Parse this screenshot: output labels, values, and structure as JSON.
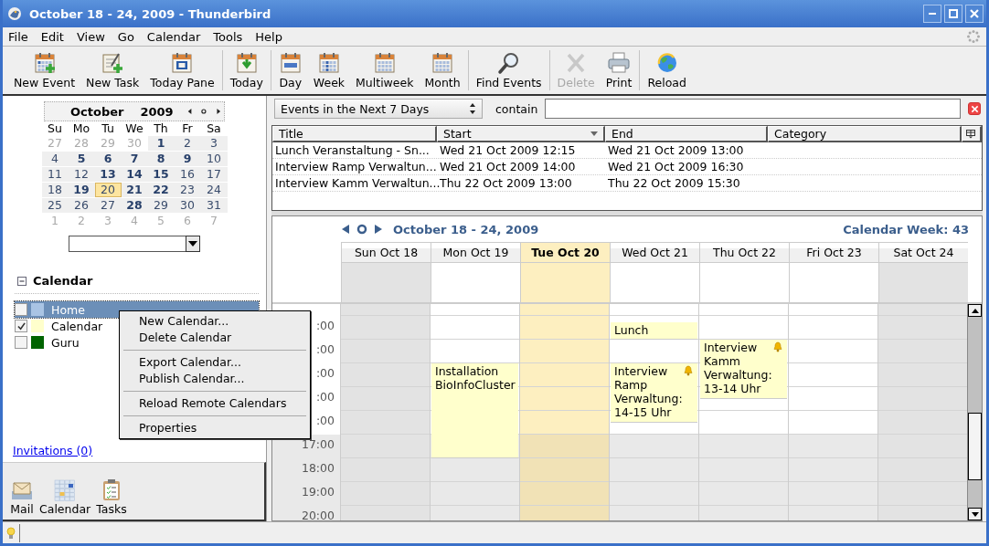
{
  "window": {
    "title": "October 18 - 24, 2009 - Thunderbird"
  },
  "menubar": [
    {
      "label": "File"
    },
    {
      "label": "Edit"
    },
    {
      "label": "View"
    },
    {
      "label": "Go"
    },
    {
      "label": "Calendar"
    },
    {
      "label": "Tools"
    },
    {
      "label": "Help"
    }
  ],
  "toolbar": [
    [
      {
        "label": "New Event",
        "kind": "new-event",
        "disabled": false
      },
      {
        "label": "New Task",
        "kind": "new-task",
        "disabled": false
      },
      {
        "label": "Today Pane",
        "kind": "today-pane",
        "disabled": false
      }
    ],
    [
      {
        "label": "Today",
        "kind": "today",
        "disabled": false
      }
    ],
    [
      {
        "label": "Day",
        "kind": "day",
        "disabled": false
      },
      {
        "label": "Week",
        "kind": "week",
        "disabled": false
      },
      {
        "label": "Multiweek",
        "kind": "multiweek",
        "disabled": false
      },
      {
        "label": "Month",
        "kind": "month",
        "disabled": false
      }
    ],
    [
      {
        "label": "Find Events",
        "kind": "find",
        "disabled": false
      }
    ],
    [
      {
        "label": "Delete",
        "kind": "delete",
        "disabled": true
      },
      {
        "label": "Print",
        "kind": "print",
        "disabled": false
      }
    ],
    [
      {
        "label": "Reload",
        "kind": "reload",
        "disabled": false
      }
    ]
  ],
  "minimonth": {
    "month": "October",
    "year": "2009",
    "weekdays": [
      "Su",
      "Mo",
      "Tu",
      "We",
      "Th",
      "Fr",
      "Sa"
    ],
    "weeks": [
      [
        {
          "text": "27",
          "in_month": false,
          "bold": false,
          "selected": false
        },
        {
          "text": "28",
          "in_month": false,
          "bold": false,
          "selected": false
        },
        {
          "text": "29",
          "in_month": false,
          "bold": false,
          "selected": false
        },
        {
          "text": "30",
          "in_month": false,
          "bold": false,
          "selected": false
        },
        {
          "text": "1",
          "in_month": true,
          "bold": true,
          "selected": false
        },
        {
          "text": "2",
          "in_month": true,
          "bold": false,
          "selected": false
        },
        {
          "text": "3",
          "in_month": true,
          "bold": false,
          "selected": false
        }
      ],
      [
        {
          "text": "4",
          "in_month": true,
          "bold": false,
          "selected": false
        },
        {
          "text": "5",
          "in_month": true,
          "bold": true,
          "selected": false
        },
        {
          "text": "6",
          "in_month": true,
          "bold": true,
          "selected": false
        },
        {
          "text": "7",
          "in_month": true,
          "bold": true,
          "selected": false
        },
        {
          "text": "8",
          "in_month": true,
          "bold": true,
          "selected": false
        },
        {
          "text": "9",
          "in_month": true,
          "bold": true,
          "selected": false
        },
        {
          "text": "10",
          "in_month": true,
          "bold": false,
          "selected": false
        }
      ],
      [
        {
          "text": "11",
          "in_month": true,
          "bold": false,
          "selected": false
        },
        {
          "text": "12",
          "in_month": true,
          "bold": false,
          "selected": false
        },
        {
          "text": "13",
          "in_month": true,
          "bold": true,
          "selected": false
        },
        {
          "text": "14",
          "in_month": true,
          "bold": true,
          "selected": false
        },
        {
          "text": "15",
          "in_month": true,
          "bold": true,
          "selected": false
        },
        {
          "text": "16",
          "in_month": true,
          "bold": false,
          "selected": false
        },
        {
          "text": "17",
          "in_month": true,
          "bold": false,
          "selected": false
        }
      ],
      [
        {
          "text": "18",
          "in_month": true,
          "bold": false,
          "selected": false
        },
        {
          "text": "19",
          "in_month": true,
          "bold": true,
          "selected": false
        },
        {
          "text": "20",
          "in_month": true,
          "bold": false,
          "selected": true
        },
        {
          "text": "21",
          "in_month": true,
          "bold": true,
          "selected": false
        },
        {
          "text": "22",
          "in_month": true,
          "bold": true,
          "selected": false
        },
        {
          "text": "23",
          "in_month": true,
          "bold": false,
          "selected": false
        },
        {
          "text": "24",
          "in_month": true,
          "bold": false,
          "selected": false
        }
      ],
      [
        {
          "text": "25",
          "in_month": true,
          "bold": false,
          "selected": false
        },
        {
          "text": "26",
          "in_month": true,
          "bold": false,
          "selected": false
        },
        {
          "text": "27",
          "in_month": true,
          "bold": false,
          "selected": false
        },
        {
          "text": "28",
          "in_month": true,
          "bold": true,
          "selected": false
        },
        {
          "text": "29",
          "in_month": true,
          "bold": false,
          "selected": false
        },
        {
          "text": "30",
          "in_month": true,
          "bold": false,
          "selected": false
        },
        {
          "text": "31",
          "in_month": true,
          "bold": false,
          "selected": false
        }
      ],
      [
        {
          "text": "1",
          "in_month": false,
          "bold": false,
          "selected": false
        },
        {
          "text": "2",
          "in_month": false,
          "bold": false,
          "selected": false
        },
        {
          "text": "3",
          "in_month": false,
          "bold": false,
          "selected": false
        },
        {
          "text": "4",
          "in_month": false,
          "bold": false,
          "selected": false
        },
        {
          "text": "5",
          "in_month": false,
          "bold": false,
          "selected": false
        },
        {
          "text": "6",
          "in_month": false,
          "bold": false,
          "selected": false
        },
        {
          "text": "7",
          "in_month": false,
          "bold": false,
          "selected": false
        }
      ]
    ]
  },
  "calendar_list": {
    "title": "Calendar",
    "expanded": true,
    "items": [
      {
        "name": "Home",
        "checked": false,
        "selected": true,
        "color": "#a9c4e4"
      },
      {
        "name": "Calendar",
        "checked": true,
        "selected": false,
        "color": "#ffffcc"
      },
      {
        "name": "Guru",
        "checked": false,
        "selected": false,
        "color": "#006400"
      }
    ]
  },
  "invitations": "Invitations (0)",
  "modes": [
    {
      "label": "Mail",
      "kind": "mail"
    },
    {
      "label": "Calendar",
      "kind": "calendar"
    },
    {
      "label": "Tasks",
      "kind": "tasks"
    }
  ],
  "filter": {
    "range": "Events in the Next 7 Days",
    "label": "contain"
  },
  "event_list": {
    "columns": [
      {
        "label": "Title",
        "sorted": false
      },
      {
        "label": "Start",
        "sorted": true
      },
      {
        "label": "End",
        "sorted": false
      },
      {
        "label": "Category",
        "sorted": false
      }
    ],
    "rows": [
      {
        "title": "Lunch Veranstaltung - Sn...",
        "start": "Wed 21 Oct 2009 12:15",
        "end": "Wed 21 Oct 2009 13:00"
      },
      {
        "title": "Interview Ramp Verwaltun...",
        "start": "Wed 21 Oct 2009 14:00",
        "end": "Wed 21 Oct 2009 16:30"
      },
      {
        "title": "Interview Kamm Verwaltun...",
        "start": "Thu 22 Oct 2009 13:00",
        "end": "Thu 22 Oct 2009 15:30"
      }
    ]
  },
  "week_view": {
    "title": "October 18 - 24, 2009",
    "week_label": "Calendar Week: 43",
    "days": [
      {
        "label": "Sun Oct 18",
        "weekend": true,
        "today": false
      },
      {
        "label": "Mon Oct 19",
        "weekend": false,
        "today": false,
        "events": [
          {
            "title": "Installation BioInfoCluster",
            "alarm": false
          }
        ]
      },
      {
        "label": "Tue Oct 20",
        "weekend": false,
        "today": true
      },
      {
        "label": "Wed Oct 21",
        "weekend": false,
        "today": false,
        "events": [
          {
            "title": "Lunch",
            "alarm": false
          },
          {
            "title": "Interview Ramp Verwaltung: 14-15 Uhr",
            "alarm": true
          }
        ]
      },
      {
        "label": "Thu Oct 22",
        "weekend": false,
        "today": false,
        "events": [
          {
            "title": "Interview Kamm Verwaltung: 13-14 Uhr",
            "alarm": true
          }
        ]
      },
      {
        "label": "Fri Oct 23",
        "weekend": false,
        "today": false
      },
      {
        "label": "Sat Oct 24",
        "weekend": true,
        "today": false
      }
    ],
    "hours": [
      {
        "label": ":00",
        "work": true
      },
      {
        "label": ":00",
        "work": true
      },
      {
        "label": ":00",
        "work": true
      },
      {
        "label": ":00",
        "work": true
      },
      {
        "label": ":00",
        "work": true
      },
      {
        "label": "17:00",
        "work": false
      },
      {
        "label": "18:00",
        "work": false
      },
      {
        "label": "19:00",
        "work": false
      },
      {
        "label": "20:00",
        "work": false
      }
    ]
  },
  "context_menu": {
    "groups": [
      [
        {
          "label": "New Calendar..."
        },
        {
          "label": "Delete Calendar"
        }
      ],
      [
        {
          "label": "Export Calendar..."
        },
        {
          "label": "Publish Calendar..."
        }
      ],
      [
        {
          "label": "Reload Remote Calendars"
        }
      ],
      [
        {
          "label": "Properties"
        }
      ]
    ]
  }
}
